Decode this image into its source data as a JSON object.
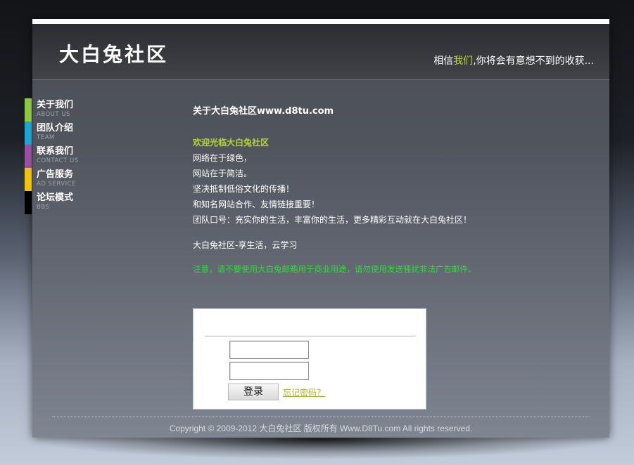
{
  "header": {
    "logo": "大白兔社区",
    "slogan_pre": "相信",
    "slogan_hl": "我们",
    "slogan_post": ",你将会有意想不到的收获..."
  },
  "nav": {
    "items": [
      {
        "label": "关于我们",
        "sub": "ABOUT US",
        "color": "#8dc63f"
      },
      {
        "label": "团队介绍",
        "sub": "TEAM",
        "color": "#1ba7d6"
      },
      {
        "label": "联系我们",
        "sub": "CONTACT US",
        "color": "#9b4fa2"
      },
      {
        "label": "广告服务",
        "sub": "AD SERVICE",
        "color": "#f2c300"
      },
      {
        "label": "论坛模式",
        "sub": "BBS",
        "color": "#000000"
      }
    ]
  },
  "content": {
    "title": "关于大白兔社区www.d8tu.com",
    "welcome": "欢迎光临大白兔社区",
    "lines": [
      "网络在于绿色，",
      "网站在于简洁。",
      "坚决抵制低俗文化的传播！",
      "和知名网站合作、友情链接重要！",
      "团队口号：充实你的生活，丰富你的生活，更多精彩互动就在大白兔社区！"
    ],
    "motto": "大白兔社区-享生活，云学习",
    "notice": "注意，请不要使用大白兔邮箱用于商业用途，请勿使用发送骚扰非法广告邮件。"
  },
  "login": {
    "username_value": "",
    "password_value": "",
    "button": "登录",
    "forgot": "忘记密码？"
  },
  "footer": {
    "copyright": "Copyright © 2009-2012 大白兔社区 版权所有 Www.D8Tu.com All rights reserved."
  },
  "colors": {
    "accent": "#b7d434",
    "notice": "#2fde3a"
  }
}
